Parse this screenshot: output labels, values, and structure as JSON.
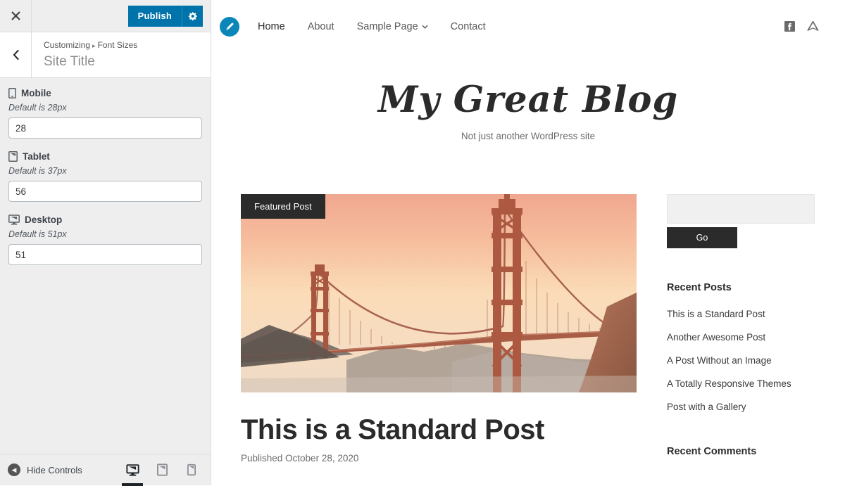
{
  "customizer": {
    "close_label": "✕",
    "publish_label": "Publish",
    "gear_icon": "gear-icon",
    "back_label": "‹",
    "breadcrumb_prefix": "Customizing",
    "breadcrumb_separator": "▸",
    "breadcrumb_section": "Font Sizes",
    "panel_title": "Site Title",
    "controls": [
      {
        "label": "Mobile",
        "icon": "smartphone-icon",
        "description": "Default is 28px",
        "value": "28"
      },
      {
        "label": "Tablet",
        "icon": "tablet-icon",
        "description": "Default is 37px",
        "value": "56"
      },
      {
        "label": "Desktop",
        "icon": "monitor-icon",
        "description": "Default is 51px",
        "value": "51"
      }
    ],
    "footer": {
      "hide_controls_label": "Hide Controls",
      "devices": [
        {
          "name": "desktop",
          "label": "Desktop",
          "active": true
        },
        {
          "name": "tablet",
          "label": "Tablet",
          "active": false
        },
        {
          "name": "mobile",
          "label": "Mobile",
          "active": false
        }
      ]
    },
    "colors": {
      "publish_blue": "#0073aa",
      "panel_bg": "#eeeeee"
    }
  },
  "preview": {
    "logo_icon": "pencil-logo-icon",
    "nav": [
      {
        "label": "Home",
        "active": true,
        "has_dropdown": false
      },
      {
        "label": "About",
        "active": false,
        "has_dropdown": false
      },
      {
        "label": "Sample Page",
        "active": false,
        "has_dropdown": true
      },
      {
        "label": "Contact",
        "active": false,
        "has_dropdown": false
      }
    ],
    "dropdown_caret": "⌄",
    "social": [
      {
        "name": "facebook-icon",
        "label": "Facebook"
      },
      {
        "name": "crossed-paddles-icon",
        "label": "Social"
      }
    ],
    "site_title": "My Great Blog",
    "site_tagline": "Not just another WordPress site",
    "featured": {
      "badge": "Featured Post",
      "image_alt": "Golden Gate Bridge at sunset"
    },
    "post": {
      "title": "This is a Standard Post",
      "meta": "Published October 28, 2020"
    },
    "sidebar": {
      "search_value": "",
      "search_placeholder": "",
      "go_label": "Go",
      "recent_posts_title": "Recent Posts",
      "recent_posts": [
        "This is a Standard Post",
        "Another Awesome Post",
        "A Post Without an Image",
        "A Totally Responsive Themes",
        "Post with a Gallery"
      ],
      "recent_comments_title": "Recent Comments"
    },
    "colors": {
      "logo_blue": "#0b86b8",
      "dark": "#2b2b2b",
      "search_bg": "#f0f0f0"
    }
  }
}
